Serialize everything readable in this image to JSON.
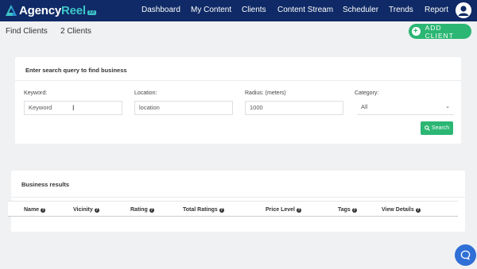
{
  "brand": {
    "name_main": "Agency",
    "name_accent": "Reel",
    "version": "2.0"
  },
  "nav": {
    "items": [
      {
        "label": "Dashboard"
      },
      {
        "label": "My Content"
      },
      {
        "label": "Clients"
      },
      {
        "label": "Content Stream"
      },
      {
        "label": "Scheduler"
      },
      {
        "label": "Trends"
      },
      {
        "label": "Report"
      }
    ]
  },
  "page": {
    "title": "Find Clients",
    "client_count": "2 Clients",
    "add_client_label": "ADD CLIENT"
  },
  "search": {
    "heading": "Enter search query to find business",
    "keyword": {
      "label": "Keyword:",
      "value": "Keyword"
    },
    "location": {
      "label": "Location:",
      "value": "location"
    },
    "radius": {
      "label": "Radius: (meters)",
      "value": "1000"
    },
    "category": {
      "label": "Category:",
      "selected": "All"
    },
    "button_label": "Search"
  },
  "results": {
    "heading": "Business results",
    "columns": [
      "Name",
      "Vicinity",
      "Rating",
      "Total Ratings",
      "Price Level",
      "Tags",
      "View Details"
    ],
    "rows": []
  },
  "colors": {
    "navbar": "#0f2a66",
    "accent_green": "#2bb673",
    "brand_teal": "#3ec6c8",
    "chat_blue": "#2f6fd6"
  },
  "icons": {
    "logo": "agencyreel-logo",
    "avatar": "user-avatar-icon",
    "add": "plus-icon",
    "search": "search-icon",
    "dropdown": "chevron-down-icon",
    "help": "question-circle-icon",
    "chat": "chat-bubble-icon"
  }
}
